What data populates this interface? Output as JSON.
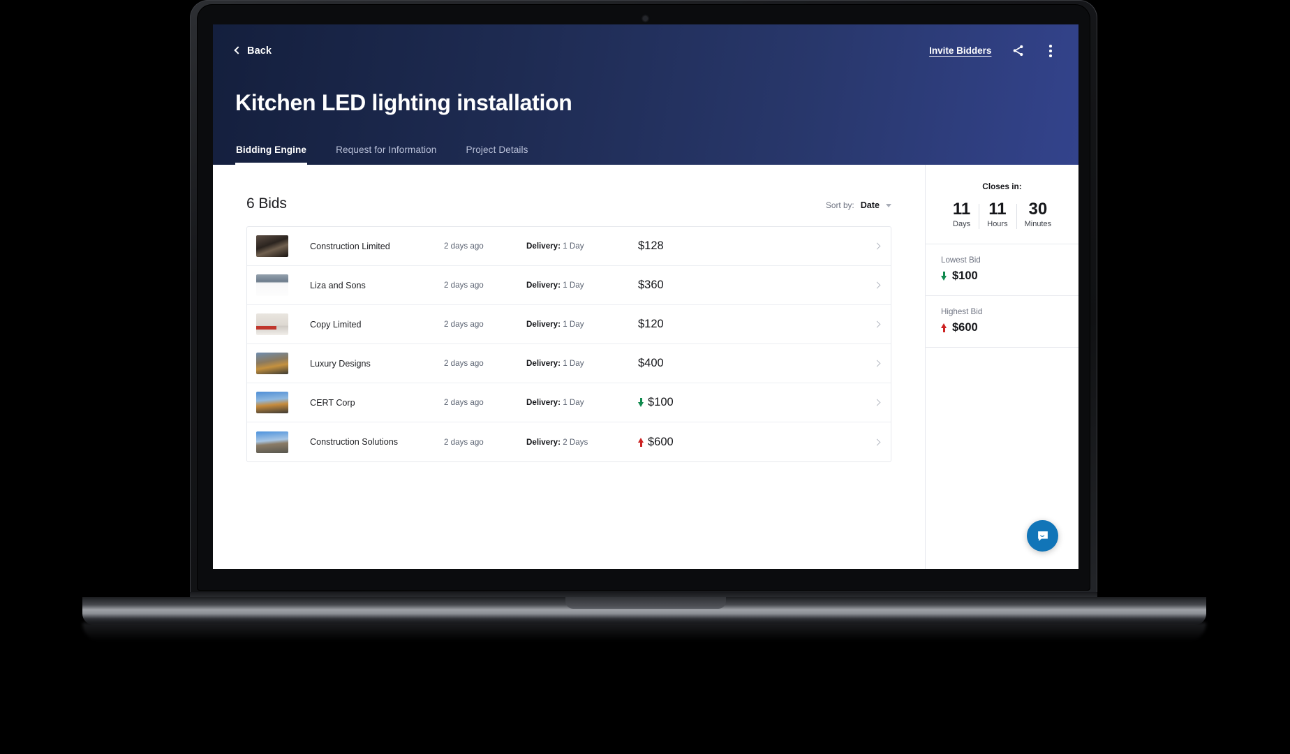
{
  "header": {
    "back_label": "Back",
    "invite_label": "Invite Bidders",
    "share_icon": "share-icon",
    "more_icon": "more-vertical-icon",
    "title": "Kitchen LED lighting installation",
    "gradient_from": "#141f3d",
    "gradient_to": "#33438c"
  },
  "tabs": [
    {
      "label": "Bidding Engine",
      "active": true
    },
    {
      "label": "Request for Information",
      "active": false
    },
    {
      "label": "Project Details",
      "active": false
    }
  ],
  "main": {
    "bids_count_label": "6 Bids",
    "sort": {
      "label": "Sort by:",
      "value": "Date",
      "caret_icon": "chevron-down-icon"
    },
    "rows": [
      {
        "company": "Construction Limited",
        "time": "2 days ago",
        "delivery_label": "Delivery:",
        "delivery_value": "1 Day",
        "amount": "$128",
        "trend": "none"
      },
      {
        "company": "Liza and Sons",
        "time": "2 days ago",
        "delivery_label": "Delivery:",
        "delivery_value": "1 Day",
        "amount": "$360",
        "trend": "none"
      },
      {
        "company": "Copy Limited",
        "time": "2 days ago",
        "delivery_label": "Delivery:",
        "delivery_value": "1 Day",
        "amount": "$120",
        "trend": "none"
      },
      {
        "company": "Luxury Designs",
        "time": "2 days ago",
        "delivery_label": "Delivery:",
        "delivery_value": "1 Day",
        "amount": "$400",
        "trend": "none"
      },
      {
        "company": "CERT Corp",
        "time": "2 days ago",
        "delivery_label": "Delivery:",
        "delivery_value": "1 Day",
        "amount": "$100",
        "trend": "down"
      },
      {
        "company": "Construction Solutions",
        "time": "2 days ago",
        "delivery_label": "Delivery:",
        "delivery_value": "2 Days",
        "amount": "$600",
        "trend": "up"
      }
    ]
  },
  "sidebar": {
    "closes_label": "Closes in:",
    "countdown": [
      {
        "value": "11",
        "unit": "Days"
      },
      {
        "value": "11",
        "unit": "Hours"
      },
      {
        "value": "30",
        "unit": "Minutes"
      }
    ],
    "lowest": {
      "label": "Lowest Bid",
      "value": "$100",
      "trend": "down",
      "color": "#108a4e"
    },
    "highest": {
      "label": "Highest Bid",
      "value": "$600",
      "trend": "up",
      "color": "#cc2222"
    }
  },
  "chat": {
    "icon": "chat-bubble-icon",
    "color": "#1175b8"
  }
}
